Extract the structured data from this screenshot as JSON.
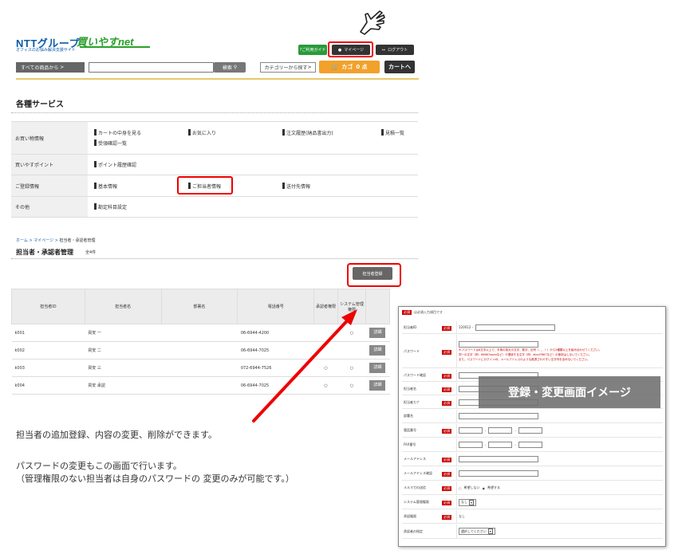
{
  "header": {
    "logo_ntt": "NTTグループ",
    "logo_kaiyasu": "買いやすnet",
    "logo_sub": "オフィスのお悩み解決支援サイト",
    "guide_label": "ご利用ガイド",
    "mypage_label": "マイページ",
    "logout_label": "ログアウト",
    "category_btn": "すべての商品から",
    "search_placeholder": "",
    "search_btn": "検索",
    "category_search": "カテゴリーから探す",
    "cart_label": "カゴ",
    "cart_count": "0 点",
    "cart_go": "カートへ"
  },
  "services": {
    "title": "各種サービス",
    "rows": [
      {
        "label": "お買い物情報",
        "links": [
          "カートの中身を見る",
          "お気に入り",
          "注文履歴(納品書出力)",
          "見積一覧",
          "受領確認一覧"
        ]
      },
      {
        "label": "買いやすポイント",
        "links": [
          "ポイント履歴確認"
        ]
      },
      {
        "label": "ご登録情報",
        "links": [
          "基本情報",
          "ご担当者情報",
          "送付先情報"
        ]
      },
      {
        "label": "その他",
        "links": [
          "勘定科目設定"
        ]
      }
    ]
  },
  "breadcrumb": {
    "home": "ホーム",
    "sep": ">",
    "mypage": "マイページ",
    "current": "担当者・承認者管理"
  },
  "page": {
    "title": "担当者・承認者管理",
    "count": "全4件",
    "register_btn": "担当者登録"
  },
  "table": {
    "headers": [
      "担当者ID",
      "担当者名",
      "部署名",
      "電話番号",
      "承認者権限",
      "システム管理権限",
      ""
    ],
    "rows": [
      {
        "id": "k001",
        "name": "買安 一",
        "dept": "",
        "tel": "06-6944-4200",
        "approver": "",
        "sysadmin": "○",
        "btn": "詳細"
      },
      {
        "id": "k002",
        "name": "買安 二",
        "dept": "",
        "tel": "06-6944-7025",
        "approver": "",
        "sysadmin": "",
        "btn": "詳細"
      },
      {
        "id": "k003",
        "name": "買安 三",
        "dept": "",
        "tel": "072-6944-7526",
        "approver": "○",
        "sysadmin": "○",
        "btn": "詳細"
      },
      {
        "id": "k004",
        "name": "買安 承認",
        "dept": "",
        "tel": "06-6944-7025",
        "approver": "○",
        "sysadmin": "○",
        "btn": "詳細"
      }
    ]
  },
  "description": {
    "line1": "担当者の追加登録、内容の変更、削除ができます。",
    "line2": "パスワードの変更もこの画面で行います。",
    "line3": "（管理権限のない担当者は自身のパスワードの 変更のみが可能です。）"
  },
  "form": {
    "required": "必須",
    "required_note": "は必須入力項目です",
    "overlay": "登録・変更画面イメージ",
    "rows": {
      "id": {
        "label": "担当者ID",
        "prefix": "120012 -"
      },
      "password": {
        "label": "パスワード",
        "note1": "※ パスワードは8文字以上で、半角の英大小文字、数字、記号（- _ . ! ）から2種類以上を組み合わせてください。",
        "note2": "同一の文字（例：66667aaaaなど）や連続する文字（例：abcd7667など）の使用はしないでください。",
        "note3": "また、パスワードにログインID、メールアドレスのような推測されやすい文字列を含めないでください。"
      },
      "password_confirm": {
        "label": "パスワード確認"
      },
      "name": {
        "label": "担当者名"
      },
      "name_kana": {
        "label": "担当者カナ"
      },
      "dept": {
        "label": "部署名"
      },
      "tel": {
        "label": "電話番号"
      },
      "fax": {
        "label": "FAX番号"
      },
      "email": {
        "label": "メールアドレス"
      },
      "email_confirm": {
        "label": "メールアドレス確認"
      },
      "mailmag": {
        "label": "メルマガの送信",
        "opt_no": "希望しない",
        "opt_yes": "希望する"
      },
      "sysadmin": {
        "label": "システム管理権限",
        "value": "なし"
      },
      "approver": {
        "label": "承認権限",
        "value": "なし"
      },
      "approver_designate": {
        "label": "承認者の指定",
        "value": "選択してください"
      }
    }
  }
}
